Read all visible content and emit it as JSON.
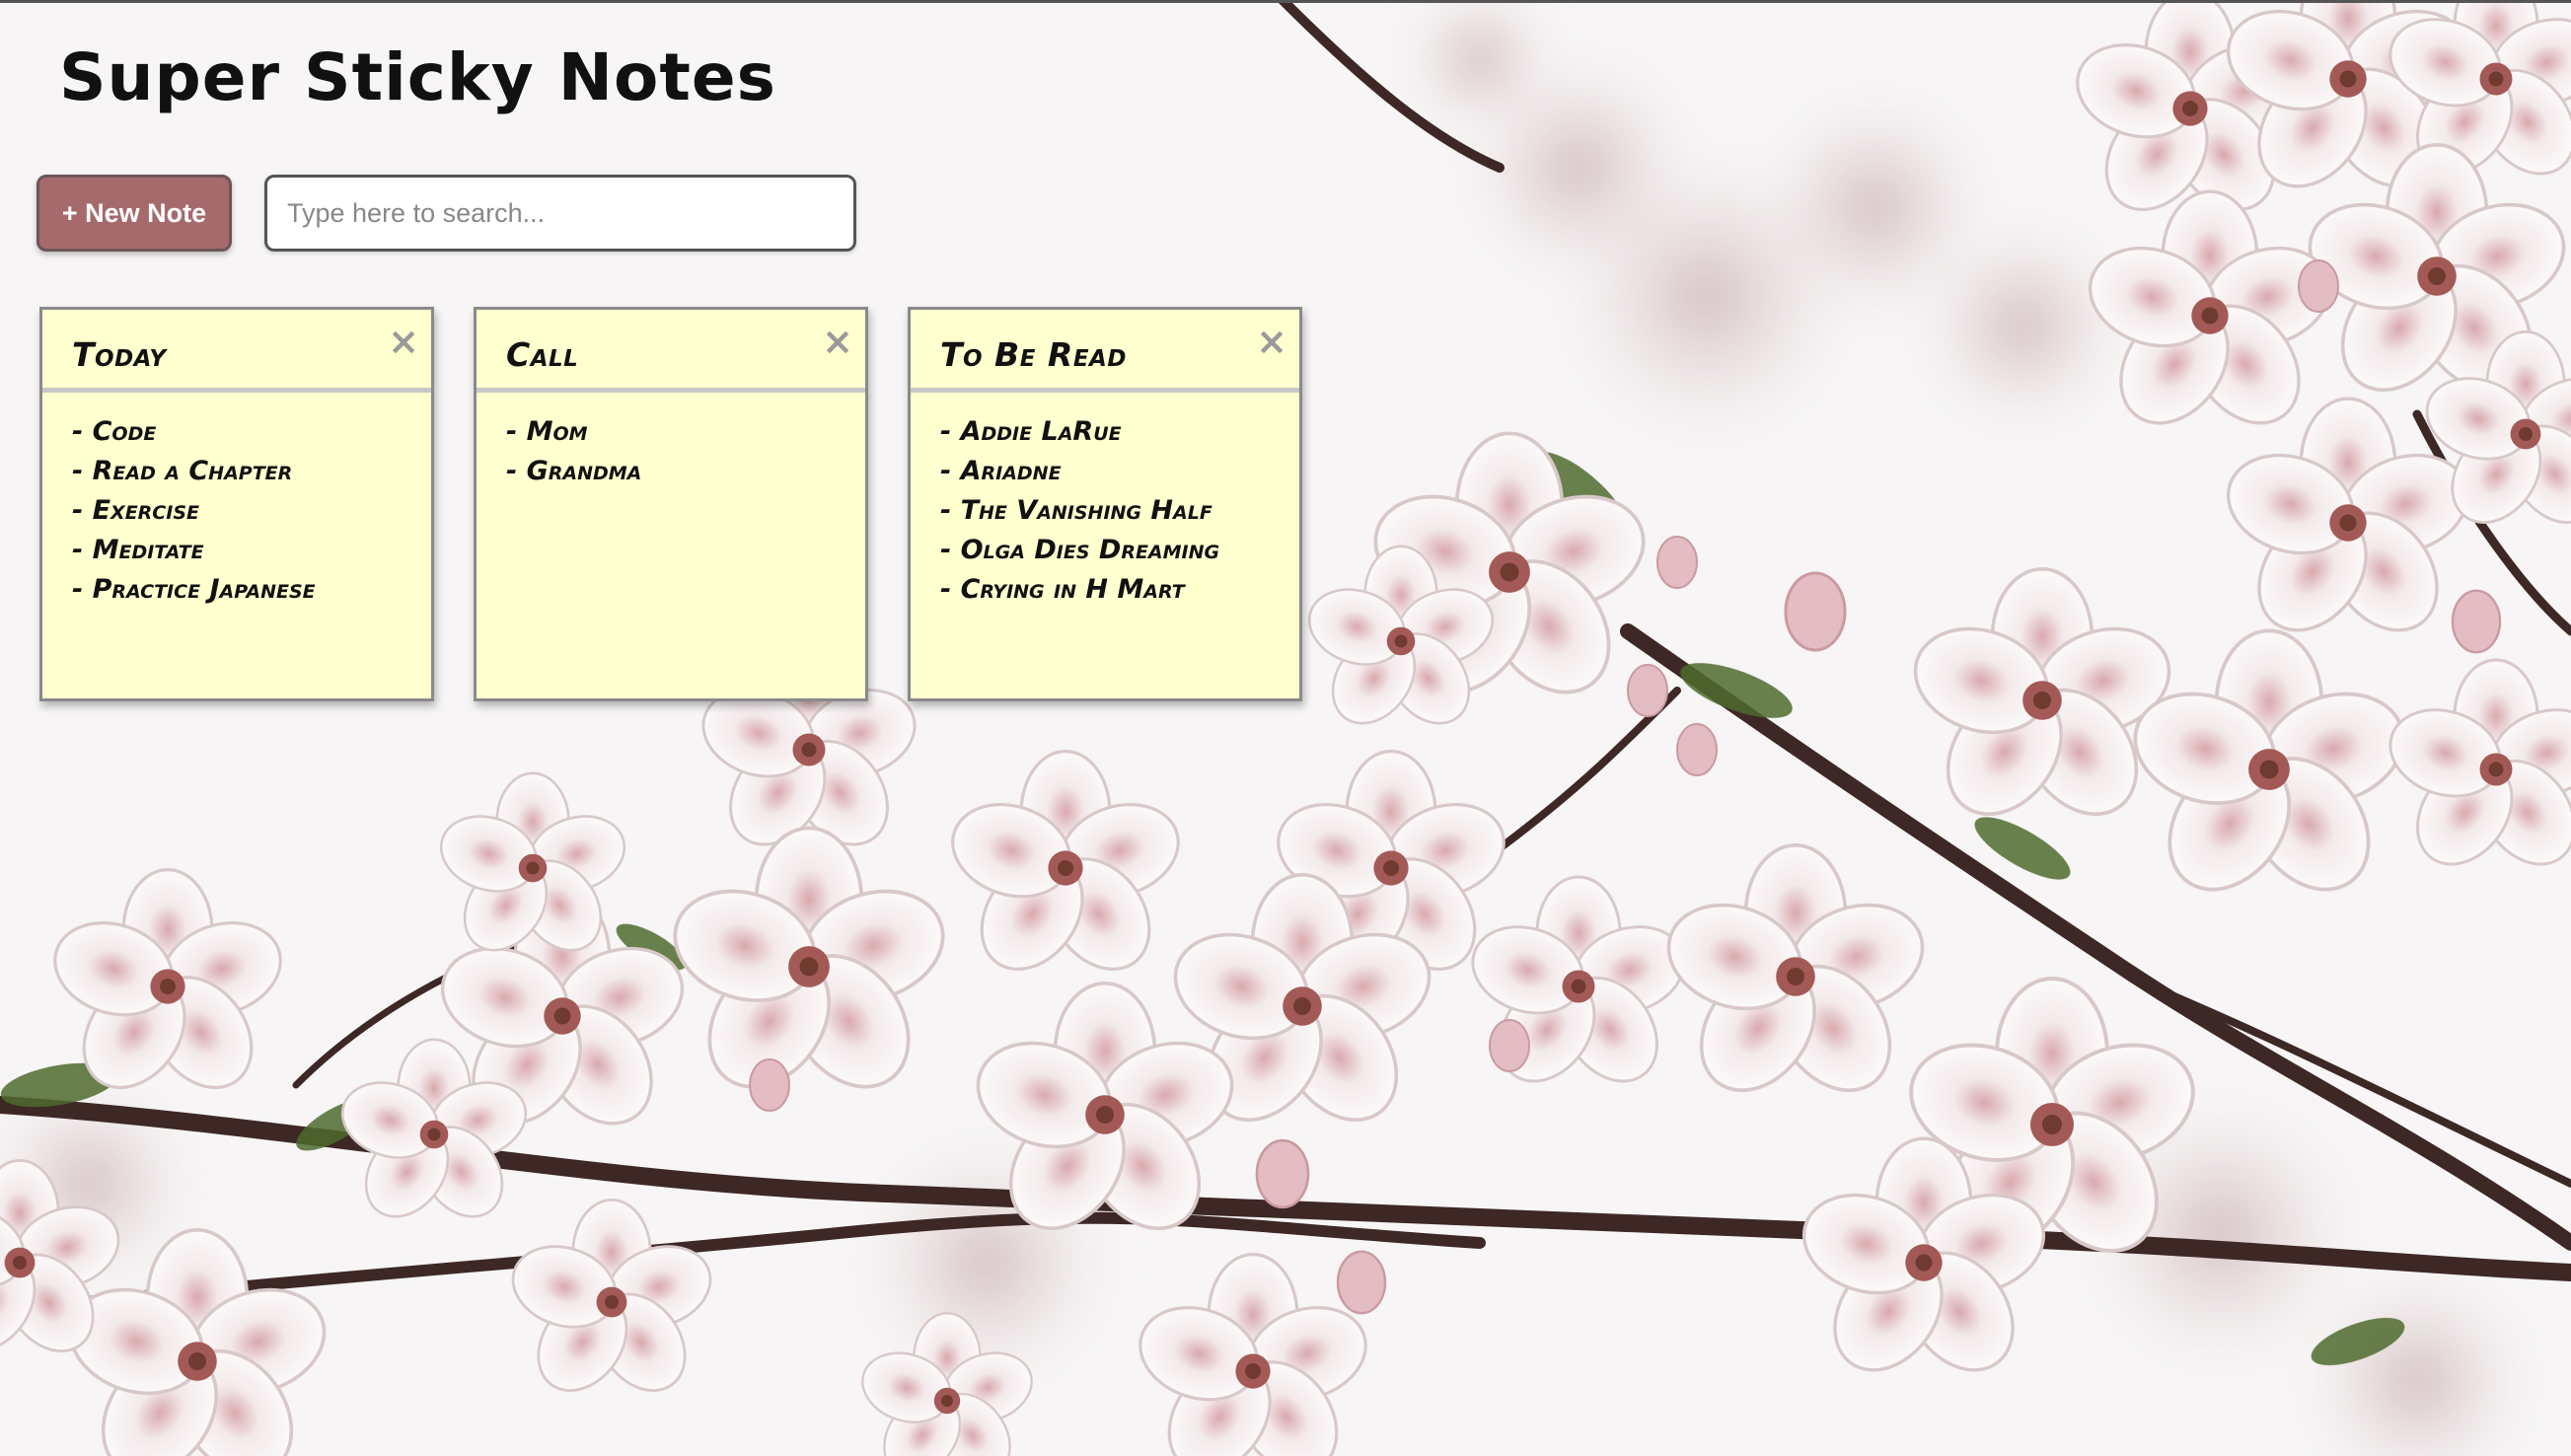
{
  "app": {
    "title": "Super Sticky Notes"
  },
  "toolbar": {
    "new_note_label": "+ New Note",
    "search_placeholder": "Type here to search...",
    "search_value": ""
  },
  "notes": [
    {
      "title": "Today",
      "close_icon": "x-icon",
      "lines": [
        "- Code",
        "- Read a Chapter",
        "- Exercise",
        "- Meditate",
        "- Practice Japanese"
      ]
    },
    {
      "title": "Call",
      "close_icon": "x-icon",
      "lines": [
        "- Mom",
        "- Grandma"
      ]
    },
    {
      "title": "To Be Read",
      "close_icon": "x-icon",
      "lines": [
        "- Addie LaRue",
        "- Ariadne",
        "- The Vanishing Half",
        "- Olga Dies Dreaming",
        "- Crying in H Mart"
      ]
    }
  ],
  "colors": {
    "note_bg": "#ffffd0",
    "button_bg": "#a66a6d",
    "close_icon": "#9a9a9a"
  },
  "background": {
    "image_subject": "cherry blossom branches"
  }
}
